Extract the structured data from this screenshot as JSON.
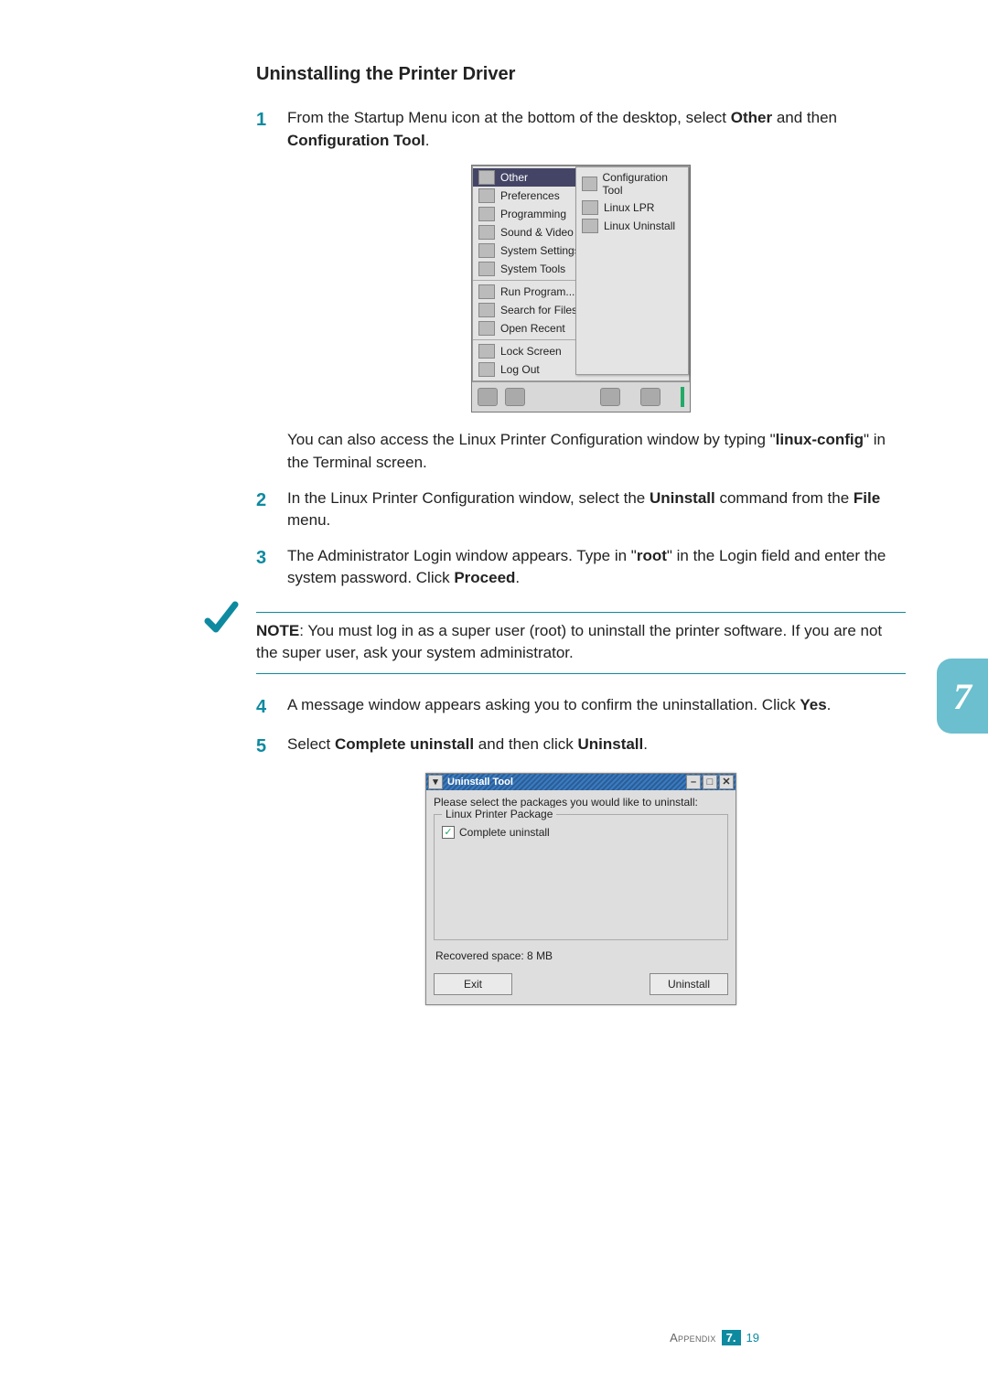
{
  "section_title": "Uninstalling the Printer Driver",
  "steps": {
    "s1_num": "1",
    "s1_a": "From the Startup Menu icon at the bottom of the desktop, select ",
    "s1_b": "Other",
    "s1_c": " and then ",
    "s1_d": "Configuration Tool",
    "s1_e": ".",
    "s1_f": "You can also access the Linux Printer Configuration window by typing \"",
    "s1_g": "linux-config",
    "s1_h": "\" in the Terminal screen.",
    "s2_num": "2",
    "s2_a": "In the Linux Printer Configuration window, select the ",
    "s2_b": "Uninstall",
    "s2_c": " command from the ",
    "s2_d": "File",
    "s2_e": " menu.",
    "s3_num": "3",
    "s3_a": "The Administrator Login window appears. Type in \"",
    "s3_b": "root",
    "s3_c": "\" in the Login field and enter the system password. Click ",
    "s3_d": "Proceed",
    "s3_e": ".",
    "s4_num": "4",
    "s4_a": "A message window appears asking you to confirm the uninstallation. Click ",
    "s4_b": "Yes",
    "s4_c": ".",
    "s5_num": "5",
    "s5_a": "Select ",
    "s5_b": "Complete uninstall",
    "s5_c": " and then click ",
    "s5_d": "Uninstall",
    "s5_e": "."
  },
  "note": {
    "label": "NOTE",
    "text": ": You must log in as a super user (root) to uninstall the printer software. If you are not the super user, ask your system administrator."
  },
  "startup_menu": {
    "items": [
      "Other",
      "Preferences",
      "Programming",
      "Sound & Video",
      "System Settings",
      "System Tools",
      "Run Program...",
      "Search for Files...",
      "Open Recent",
      "Lock Screen",
      "Log Out"
    ],
    "submenu": [
      "Configuration Tool",
      "Linux LPR",
      "Linux Uninstall"
    ]
  },
  "uninstall": {
    "title": "Uninstall Tool",
    "instruction": "Please select the packages you would like to uninstall:",
    "group": "Linux Printer Package",
    "checkbox": "Complete uninstall",
    "recovered": "Recovered space:  8 MB",
    "exit": "Exit",
    "uninstall_btn": "Uninstall"
  },
  "side_tab": "7",
  "footer": {
    "label": "Appendix",
    "chapter": "7",
    "dot": ".",
    "page": "19"
  }
}
